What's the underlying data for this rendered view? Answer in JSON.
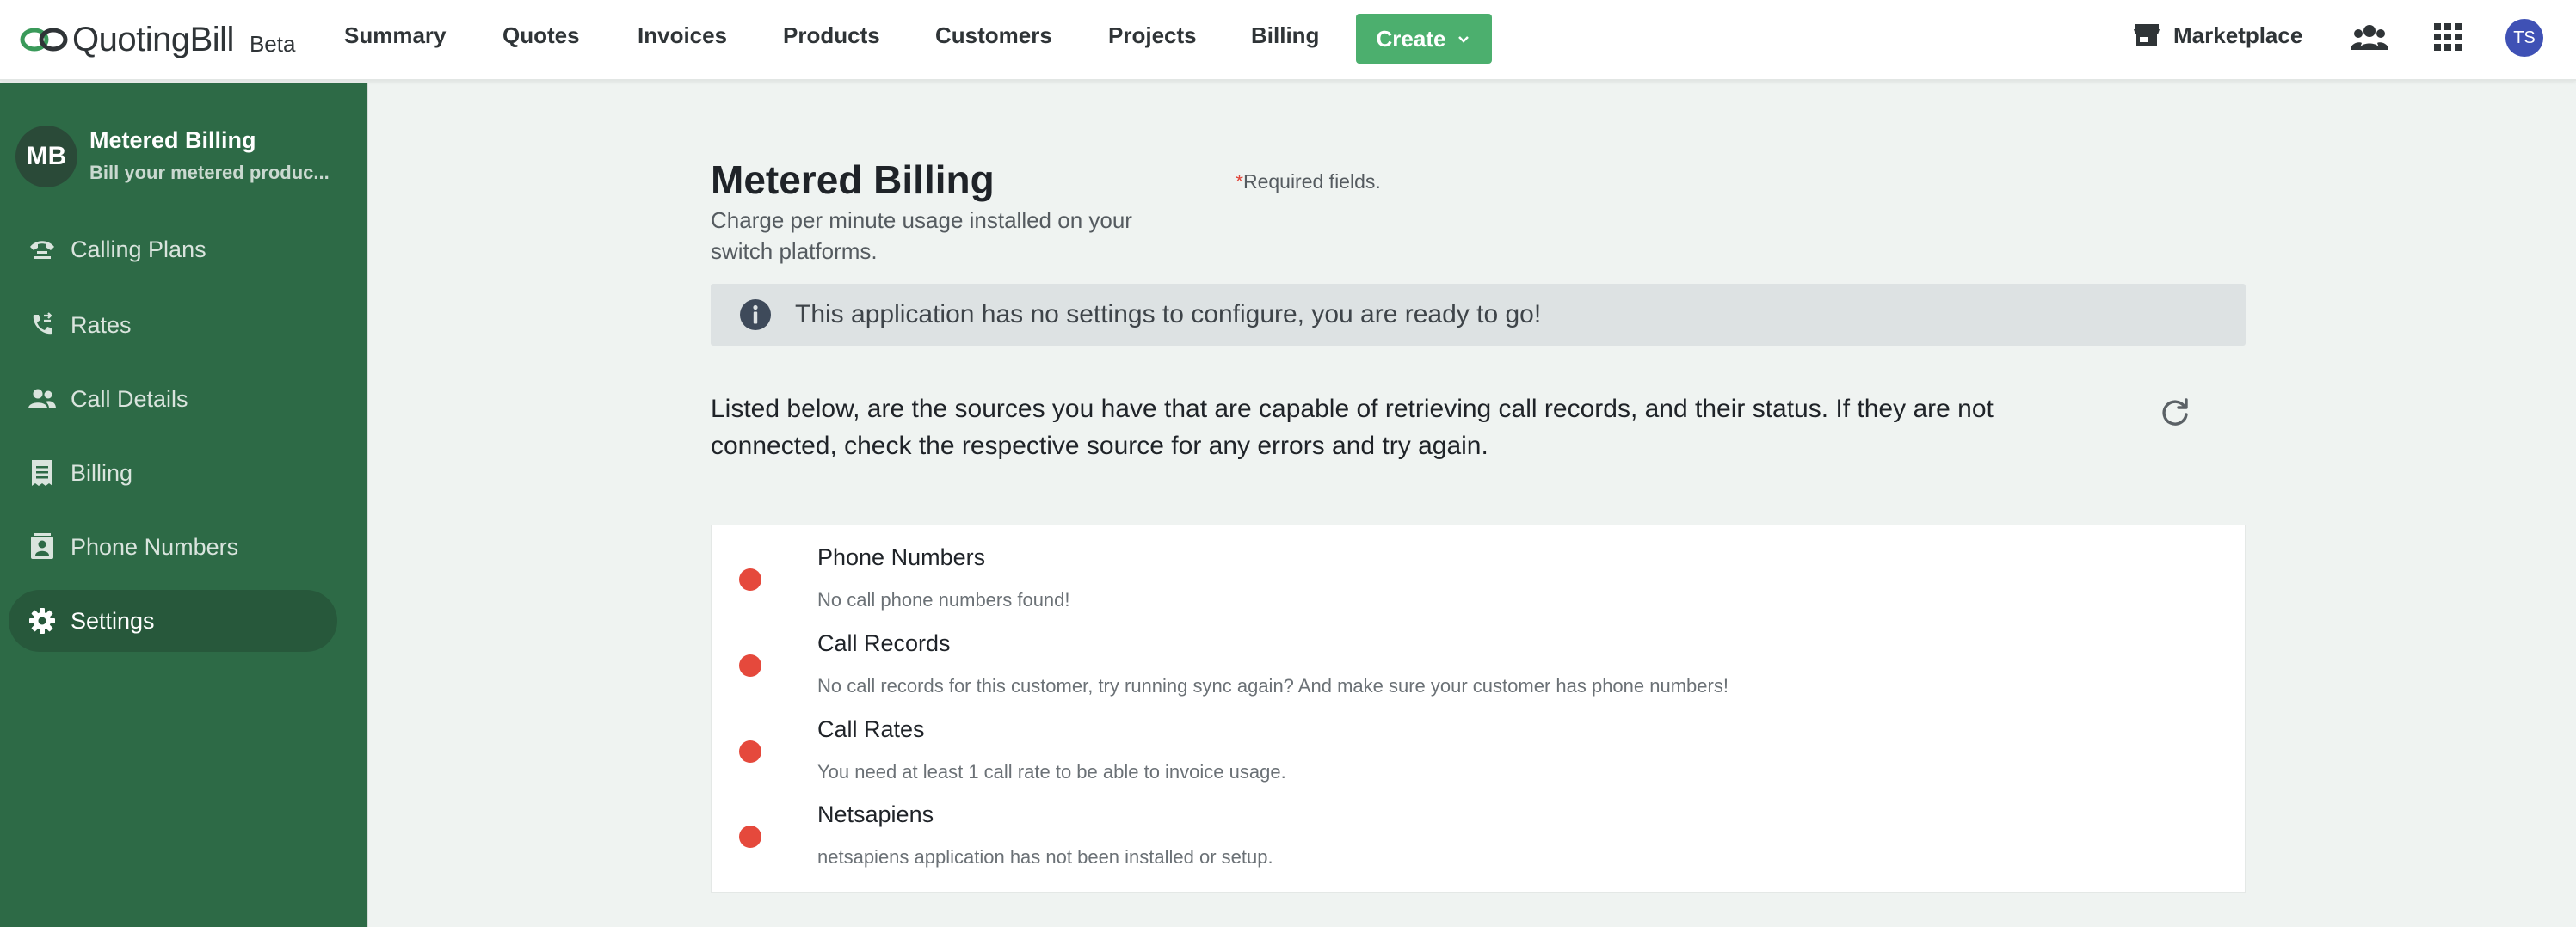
{
  "brand": {
    "name": "QuotingBill",
    "badge": "Beta"
  },
  "nav": {
    "items": [
      "Summary",
      "Quotes",
      "Invoices",
      "Products",
      "Customers",
      "Projects",
      "Billing"
    ],
    "create_label": "Create",
    "marketplace_label": "Marketplace",
    "user_initials": "TS"
  },
  "sidebar": {
    "app_initials": "MB",
    "app_title": "Metered Billing",
    "app_subtitle": "Bill your metered produc...",
    "items": [
      {
        "label": "Calling Plans",
        "icon": "calling-plans-icon"
      },
      {
        "label": "Rates",
        "icon": "phone-forward-icon"
      },
      {
        "label": "Call Details",
        "icon": "people-icon"
      },
      {
        "label": "Billing",
        "icon": "receipt-icon"
      },
      {
        "label": "Phone Numbers",
        "icon": "contact-card-icon"
      },
      {
        "label": "Settings",
        "icon": "gear-icon",
        "active": true
      }
    ]
  },
  "main": {
    "title": "Metered Billing",
    "subtitle": "Charge per minute usage installed on your switch platforms.",
    "required_star": "*",
    "required_text": "Required fields.",
    "alert_text": "This application has no settings to configure, you are ready to go!",
    "intro": "Listed below, are the sources you have that are capable of retrieving call records, and their status. If they are not connected, check the respective source for any errors and try again.",
    "sources": [
      {
        "name": "Phone Numbers",
        "message": "No call phone numbers found!",
        "status": "error"
      },
      {
        "name": "Call Records",
        "message": "No call records for this customer, try running sync again? And make sure your customer has phone numbers!",
        "status": "error"
      },
      {
        "name": "Call Rates",
        "message": "You need at least 1 call rate to be able to invoice usage.",
        "status": "error"
      },
      {
        "name": "Netsapiens",
        "message": "netsapiens application has not been installed or setup.",
        "status": "error"
      }
    ]
  },
  "colors": {
    "sidebar": "#2d6a46",
    "create_button": "#4caf6e",
    "status_error": "#e5493c",
    "avatar": "#3f51b5"
  }
}
